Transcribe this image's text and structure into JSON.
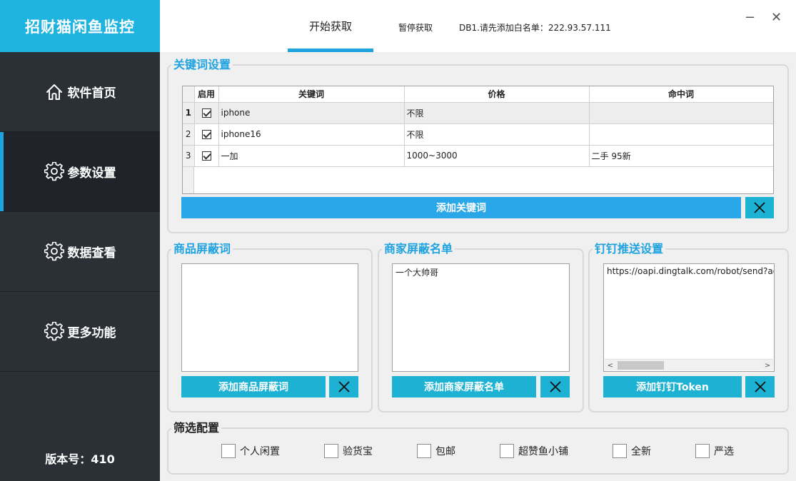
{
  "sidebar": {
    "brand": "招财猫闲鱼监控",
    "items": [
      {
        "label": "软件首页",
        "icon": "home-icon"
      },
      {
        "label": "参数设置",
        "icon": "gear-icon"
      },
      {
        "label": "数据查看",
        "icon": "gear-icon"
      },
      {
        "label": "更多功能",
        "icon": "gear-icon"
      }
    ],
    "active": "参数设置",
    "version": "版本号：410"
  },
  "topbar": {
    "start_tab": "开始获取",
    "pause_tab": "暂停获取",
    "status": "DB1.请先添加白名单：222.93.57.111",
    "minimize": "−",
    "close": "✕"
  },
  "keywords": {
    "title": "关键词设置",
    "columns": [
      "启用",
      "关键词",
      "价格",
      "命中词"
    ],
    "rows": [
      {
        "index": "1",
        "enabled": true,
        "keyword": "iphone",
        "price": "不限",
        "hit": ""
      },
      {
        "index": "2",
        "enabled": true,
        "keyword": "iphone16",
        "price": "不限",
        "hit": ""
      },
      {
        "index": "3",
        "enabled": true,
        "keyword": "一加",
        "price": "1000~3000",
        "hit": "二手 95新"
      }
    ],
    "add_button": "添加关键词"
  },
  "product_block": {
    "title": "商品屏蔽词",
    "content": "",
    "add_button": "添加商品屏蔽词"
  },
  "seller_block": {
    "title": "商家屏蔽名单",
    "content": "一个大帅哥",
    "add_button": "添加商家屏蔽名单"
  },
  "dingtalk": {
    "title": "钉钉推送设置",
    "content": "https://oapi.dingtalk.com/robot/send?acce",
    "add_button": "添加钉钉Token"
  },
  "filters": {
    "title": "筛选配置",
    "options": [
      "个人闲置",
      "验货宝",
      "包邮",
      "超赞鱼小铺",
      "全新",
      "严选"
    ]
  },
  "colors": {
    "accent": "#1fa3e0",
    "sidebar_bg": "#2b2f36",
    "brand_bg": "#1fb3e0",
    "button_teal": "#1db2d4"
  }
}
